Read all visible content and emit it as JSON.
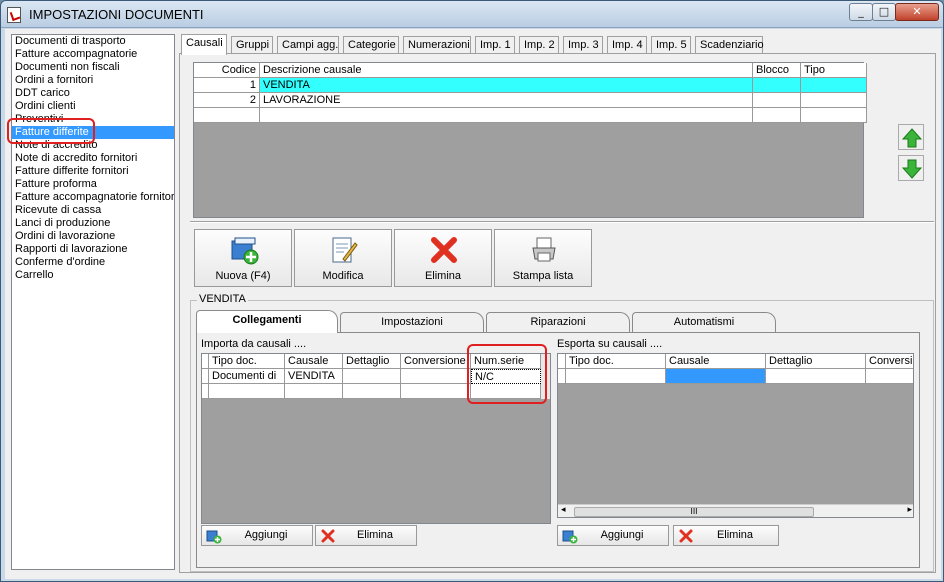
{
  "window": {
    "title": "IMPOSTAZIONI DOCUMENTI",
    "minimize": "_",
    "maximize": "□",
    "close": "✕"
  },
  "doc_types": [
    "Documenti di trasporto",
    "Fatture accompagnatorie",
    "Documenti non fiscali",
    "Ordini a fornitori",
    "DDT carico",
    "Ordini clienti",
    "Preventivi",
    "Fatture differite",
    "Note di accredito",
    "Note di accredito fornitori",
    "Fatture differite fornitori",
    "Fatture proforma",
    "Fatture accompagnatorie fornitori",
    "Ricevute di cassa",
    "Lanci di produzione",
    "Ordini di lavorazione",
    "Rapporti di lavorazione",
    "Conferme d'ordine",
    "Carrello"
  ],
  "selected_doc_type": "Fatture differite",
  "tabs": [
    "Causali",
    "Gruppi",
    "Campi agg.",
    "Categorie",
    "Numerazioni",
    "Imp. 1",
    "Imp. 2",
    "Imp. 3",
    "Imp. 4",
    "Imp. 5",
    "Scadenziario"
  ],
  "causali_grid": {
    "columns": [
      "Codice",
      "Descrizione causale",
      "Blocco",
      "Tipo"
    ],
    "rows": [
      {
        "codice": "1",
        "descrizione": "VENDITA",
        "blocco": "",
        "tipo": ""
      },
      {
        "codice": "2",
        "descrizione": "LAVORAZIONE",
        "blocco": "",
        "tipo": ""
      }
    ]
  },
  "toolbar": {
    "nuova": "Nuova (F4)",
    "modifica": "Modifica",
    "elimina": "Elimina",
    "stampa": "Stampa lista"
  },
  "group_title": "VENDITA",
  "inner_tabs": [
    "Collegamenti",
    "Impostazioni",
    "Riparazioni",
    "Automatismi"
  ],
  "importa": {
    "label": "Importa da causali ....",
    "columns": [
      "Tipo doc.",
      "Causale",
      "Dettaglio",
      "Conversione",
      "Num.serie"
    ],
    "rows": [
      {
        "tipo_doc": "Documenti di",
        "causale": "VENDITA",
        "dettaglio": "",
        "conversione": "",
        "num_serie": "N/C"
      }
    ],
    "aggiungi": "Aggiungi",
    "elimina": "Elimina"
  },
  "esporta": {
    "label": "Esporta su causali ....",
    "columns": [
      "Tipo doc.",
      "Causale",
      "Dettaglio",
      "Conversi"
    ],
    "aggiungi": "Aggiungi",
    "elimina": "Elimina",
    "scroll_left": "◂",
    "scroll_thumb": "III",
    "scroll_right": "▸"
  },
  "colors": {
    "selection": "#3399ff",
    "row_highlight": "#33ffff",
    "annotation": "#e02020"
  }
}
